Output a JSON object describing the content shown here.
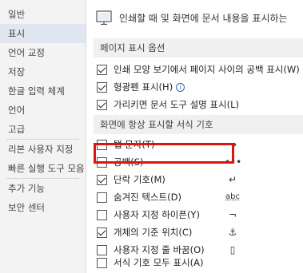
{
  "sidebar": {
    "items": [
      {
        "label": "일반"
      },
      {
        "label": "표시"
      },
      {
        "label": "언어 교정"
      },
      {
        "label": "저장"
      },
      {
        "label": "한글 입력 체계"
      },
      {
        "label": "언어"
      },
      {
        "label": "고급"
      },
      {
        "label": "리본 사용자 지정"
      },
      {
        "label": "빠른 실행 도구 모음"
      },
      {
        "label": "추가 기능"
      },
      {
        "label": "보안 센터"
      }
    ],
    "active_index": 1
  },
  "header": {
    "text": "인쇄할 때 및 화면에 문서 내용을 표시하는"
  },
  "page_display": {
    "title": "페이지 표시 옵션",
    "options": [
      {
        "label": "인쇄 모양 보기에서 페이지 사이의 공백 표시(W)",
        "checked": true
      },
      {
        "label": "형광펜 표시(H)",
        "checked": true
      },
      {
        "label": "가리키면 문서 도구 설명 표시(L)",
        "checked": true
      }
    ]
  },
  "formatting_marks": {
    "title": "화면에 항상 표시할 서식 기호",
    "options": [
      {
        "label": "탭 문자(T)",
        "glyph": "→",
        "checked": false
      },
      {
        "label": "공백(S)",
        "glyph": "•••",
        "checked": false
      },
      {
        "label": "단락 기호(M)",
        "glyph": "↵",
        "checked": true
      },
      {
        "label": "숨겨진 텍스트(D)",
        "glyph": "abc",
        "checked": false
      },
      {
        "label": "사용자 지정 하이픈(Y)",
        "glyph": "¬",
        "checked": false
      },
      {
        "label": "개체의 기준 위치(C)",
        "glyph": "⚓",
        "checked": true
      },
      {
        "label": "사용자 지정 줄 바꿈(O)",
        "glyph": "▯",
        "checked": false
      },
      {
        "label": "서식 기호 모두 표시(A)",
        "checked": false
      }
    ]
  }
}
